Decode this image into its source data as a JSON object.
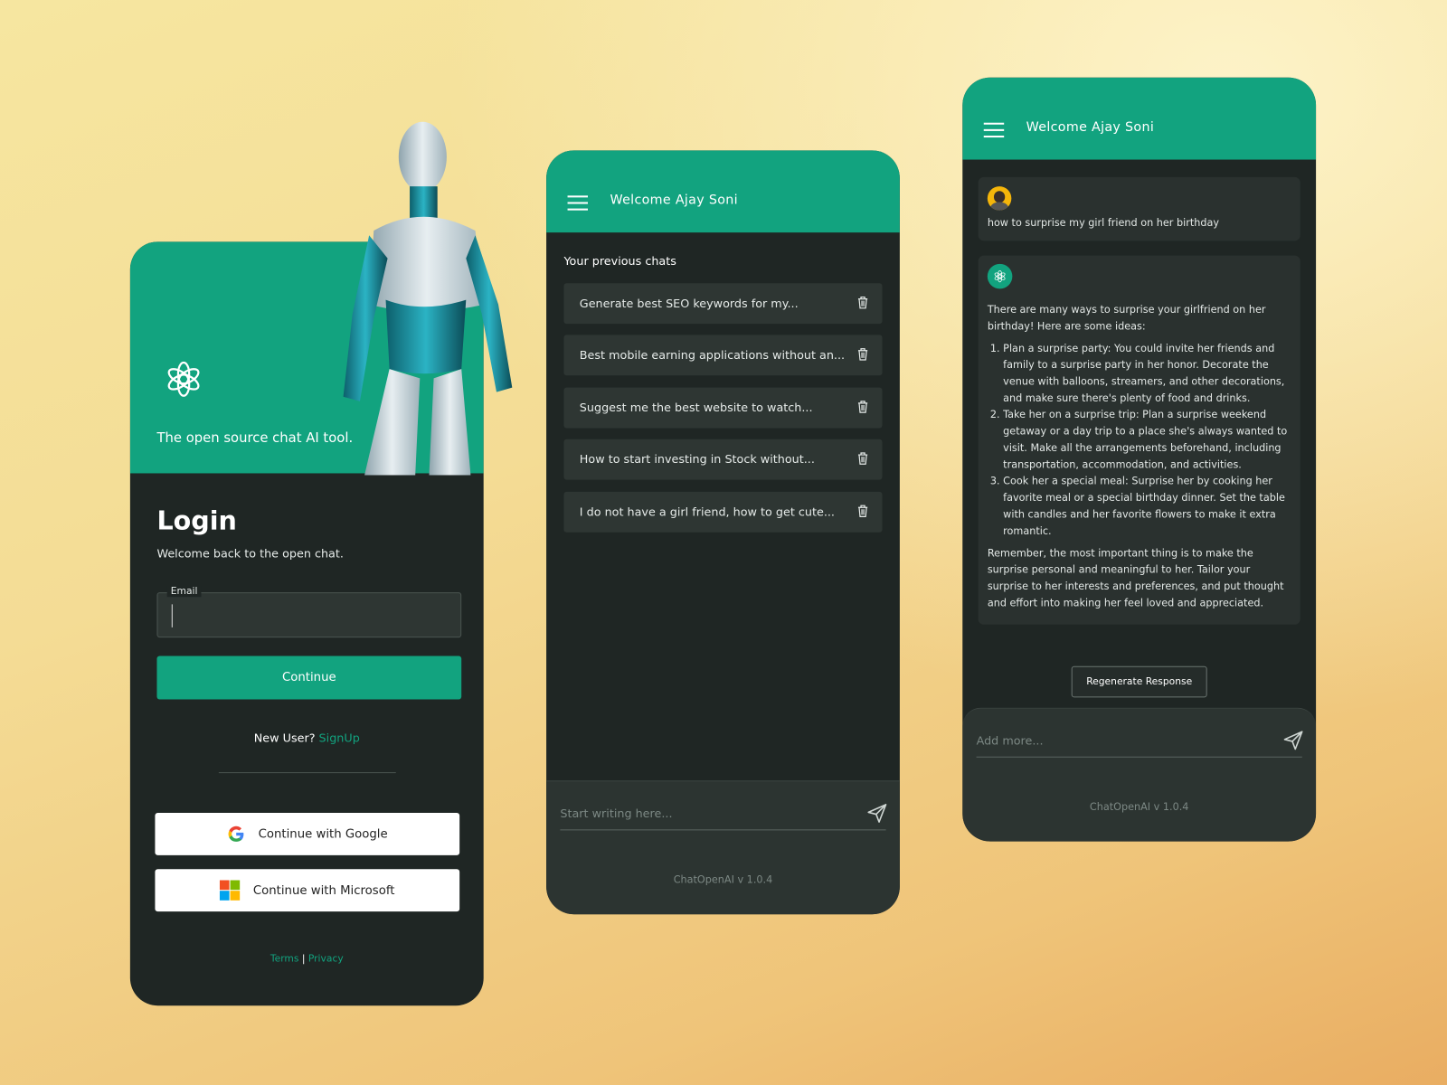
{
  "login": {
    "tagline": "The open source chat AI tool.",
    "title": "Login",
    "subtitle": "Welcome back to the open chat.",
    "email_label": "Email",
    "email_value": "",
    "continue_label": "Continue",
    "new_user_text": "New User?",
    "signup_label": "SignUp",
    "google_label": "Continue with Google",
    "microsoft_label": "Continue with Microsoft",
    "terms_label": "Terms",
    "separator": "|",
    "privacy_label": "Privacy"
  },
  "history": {
    "header_title": "Welcome Ajay Soni",
    "section_title": "Your previous chats",
    "chats": [
      {
        "title": "Generate best SEO keywords for my..."
      },
      {
        "title": "Best mobile earning applications without an..."
      },
      {
        "title": "Suggest me the best website to watch..."
      },
      {
        "title": "How to start investing in Stock without..."
      },
      {
        "title": "I do not have a girl friend, how to get cute..."
      }
    ],
    "input_placeholder": "Start writing here...",
    "version": "ChatOpenAI v 1.0.4"
  },
  "chat": {
    "header_title": "Welcome Ajay Soni",
    "user_message": "how to surprise my girl friend on her birthday",
    "reply_intro": "There are many ways to surprise your girlfriend on her birthday! Here are some ideas:",
    "reply_items": [
      "Plan a surprise party: You could invite her friends and family to a surprise party in her honor. Decorate the venue with balloons, streamers, and other decorations, and make sure there's plenty of food and drinks.",
      "Take her on a surprise trip: Plan a surprise weekend getaway or a day trip to a place she's always wanted to visit. Make all the arrangements beforehand, including transportation, accommodation, and activities.",
      "Cook her a special meal: Surprise her by cooking her favorite meal or a special birthday dinner. Set the table with candles and her favorite flowers to make it extra romantic."
    ],
    "reply_outro": "Remember, the most important thing is to make the surprise personal and meaningful to her. Tailor your surprise to her interests and preferences, and put thought and effort into making her feel loved and appreciated.",
    "regenerate_label": "Regenerate Response",
    "input_placeholder": "Add more...",
    "version": "ChatOpenAI v 1.0.4"
  },
  "colors": {
    "brand": "#12a37f",
    "panel": "#1f2624",
    "item": "#2e3633"
  }
}
